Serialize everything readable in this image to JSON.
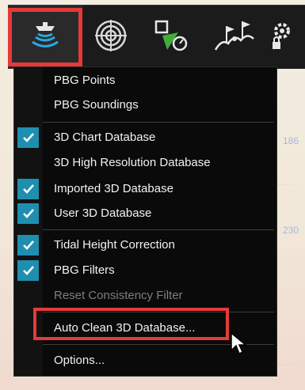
{
  "map": {
    "labels": [
      "186",
      "230"
    ]
  },
  "toolbar": {
    "tools": [
      {
        "icon": "sonar-vessel-icon",
        "active": true
      },
      {
        "icon": "target-rings-icon",
        "active": false
      },
      {
        "icon": "route-waypoint-icon",
        "active": false
      },
      {
        "icon": "flag-terrain-icon",
        "active": false
      },
      {
        "icon": "gear-lock-icon",
        "active": false
      }
    ]
  },
  "menu": {
    "items": [
      {
        "label": "PBG Points",
        "checked": false,
        "disabled": false
      },
      {
        "label": "PBG Soundings",
        "checked": false,
        "disabled": false
      },
      {
        "label": "3D Chart Database",
        "checked": true,
        "disabled": false
      },
      {
        "label": "3D High Resolution Database",
        "checked": false,
        "disabled": false
      },
      {
        "label": "Imported 3D Database",
        "checked": true,
        "disabled": false
      },
      {
        "label": "User 3D Database",
        "checked": true,
        "disabled": false
      },
      {
        "label": "Tidal Height Correction",
        "checked": true,
        "disabled": false
      },
      {
        "label": "PBG Filters",
        "checked": true,
        "disabled": false
      },
      {
        "label": "Reset Consistency Filter",
        "checked": false,
        "disabled": true
      },
      {
        "label": "Auto Clean 3D Database...",
        "checked": false,
        "disabled": false
      },
      {
        "label": "Options...",
        "checked": false,
        "disabled": false
      }
    ]
  },
  "colors": {
    "accent_check": "#1f8fb0",
    "highlight": "#e53a3a",
    "menu_bg": "#0a0a0a",
    "sonar_blue": "#29a9e0"
  }
}
